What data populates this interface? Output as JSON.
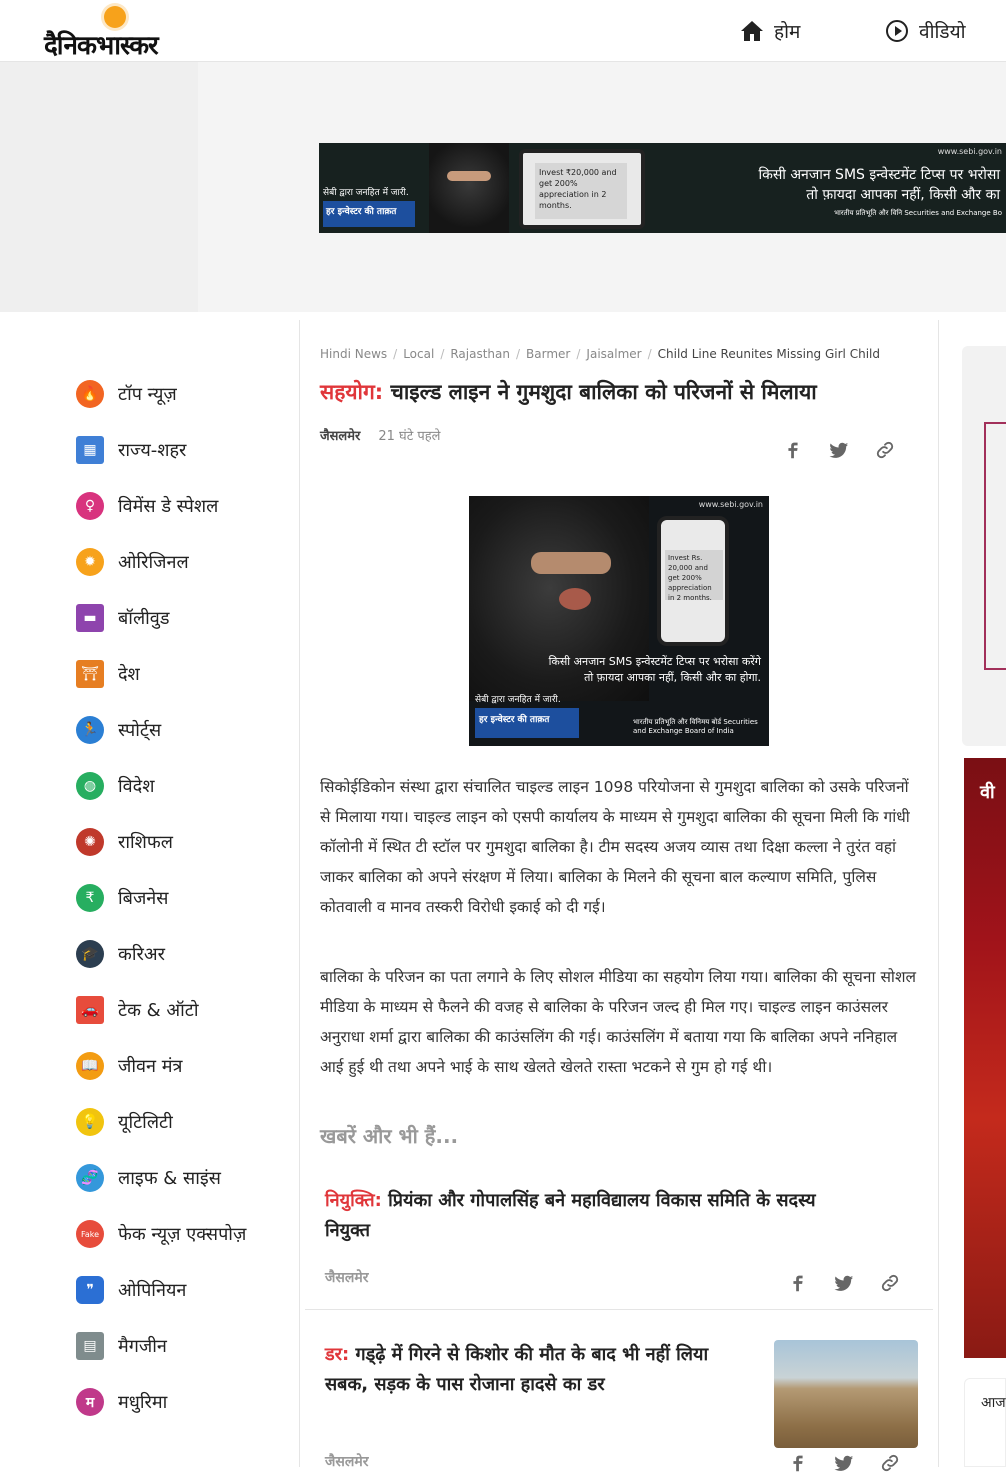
{
  "header": {
    "logo_text": "दैनिकभास्कर",
    "nav_home": "होम",
    "nav_video": "वीडियो"
  },
  "banner_ad": {
    "url": "www.sebi.gov.in",
    "sms_text": "Invest ₹20,000 and get 200% appreciation in 2 months.",
    "left_note": "सेबी द्वारा जनहित में जारी.",
    "left_badge": "हर इन्वेस्टर की ताक़त",
    "line1": "किसी अनजान SMS इन्वेस्टमेंट टिप्स पर भरोसा",
    "line2": "तो फ़ायदा आपका नहीं, किसी और का",
    "right_note": "भारतीय प्रतिभूति और विनि Securities and Exchange Bo"
  },
  "sidebar": {
    "items": [
      {
        "label": "टॉप न्यूज़",
        "icon": "flame-icon",
        "color": "#f26522"
      },
      {
        "label": "राज्य-शहर",
        "icon": "city-icon",
        "color": "#3f7fd6"
      },
      {
        "label": "विमेंस डे स्पेशल",
        "icon": "women-icon",
        "color": "#d8337e"
      },
      {
        "label": "ओरिजिनल",
        "icon": "original-icon",
        "color": "#f7a21b"
      },
      {
        "label": "बॉलीवुड",
        "icon": "clapper-icon",
        "color": "#8e44ad"
      },
      {
        "label": "देश",
        "icon": "gate-icon",
        "color": "#e67e22"
      },
      {
        "label": "स्पोर्ट्स",
        "icon": "runner-icon",
        "color": "#2b7fd4"
      },
      {
        "label": "विदेश",
        "icon": "globe-icon",
        "color": "#27ae60"
      },
      {
        "label": "राशिफल",
        "icon": "zodiac-icon",
        "color": "#c0392b"
      },
      {
        "label": "बिजनेस",
        "icon": "rupee-icon",
        "color": "#27ae60"
      },
      {
        "label": "करिअर",
        "icon": "graduation-cap-icon",
        "color": "#2c3e50"
      },
      {
        "label": "टेक & ऑटो",
        "icon": "car-icon",
        "color": "#e74c3c"
      },
      {
        "label": "जीवन मंत्र",
        "icon": "book-icon",
        "color": "#f39c12"
      },
      {
        "label": "यूटिलिटी",
        "icon": "bulb-icon",
        "color": "#f1c40f"
      },
      {
        "label": "लाइफ & साइंस",
        "icon": "dna-icon",
        "color": "#3498db"
      },
      {
        "label": "फेक न्यूज़ एक्सपोज़",
        "icon": "fake-icon",
        "color": "#e74c3c"
      },
      {
        "label": "ओपिनियन",
        "icon": "quote-icon",
        "color": "#2b6fd4"
      },
      {
        "label": "मैगजीन",
        "icon": "magazine-icon",
        "color": "#7f8c8d"
      },
      {
        "label": "मधुरिमा",
        "icon": "m-icon",
        "color": "#c0398a"
      }
    ]
  },
  "breadcrumb": [
    "Hindi News",
    "Local",
    "Rajasthan",
    "Barmer",
    "Jaisalmer",
    "Child Line Reunites Missing Girl Child"
  ],
  "article": {
    "keyword": "सहयोग:",
    "title": " चाइल्ड लाइन ने गुमशुदा बालिका को परिजनों से मिलाया",
    "city": "जैसलमेर",
    "time": "21 घंटे पहले",
    "image": {
      "url": "www.sebi.gov.in",
      "sms": "Invest Rs. 20,000 and get 200% appreciation in 2 months.",
      "line1": "किसी अनजान SMS इन्वेस्टमेंट टिप्स पर भरोसा करेंगे",
      "line2": "तो फ़ायदा आपका नहीं, किसी और का होगा.",
      "left_note": "सेबी द्वारा जनहित में जारी.",
      "badge": "हर इन्वेस्टर की ताक़त",
      "right_note": "भारतीय प्रतिभूति और विनिमय बोर्ड Securities and Exchange Board of India"
    },
    "para1": "सिकोईडिकोन संस्था द्वारा संचालित चाइल्ड लाइन 1098 परियोजना से गुमशुदा बालिका को उसके परिजनों से मिलाया गया। चाइल्ड लाइन को एसपी कार्यालय के माध्यम से गुमशुदा बालिका की सूचना मिली कि गांधी कॉलोनी में स्थित टी स्टॉल पर गुमशुदा बालिका है। टीम सदस्य अजय व्यास तथा दिक्षा कल्ला ने तुरंत वहां जाकर बालिका को अपने संरक्षण में लिया। बालिका के मिलने की सूचना बाल कल्याण समिति, पुलिस कोतवाली व मानव तस्करी विरोधी इकाई को दी गई।",
    "para2": "बालिका के परिजन का पता लगाने के लिए सोशल मीडिया का सहयोग लिया गया। बालिका की सूचना सोशल मीडिया के माध्यम से फैलने की वजह से बालिका के परिजन जल्द ही मिल गए। चाइल्ड लाइन काउंसलर अनुराधा शर्मा द्वारा बालिका की काउंसलिंग की गई। काउंसलिंग में बताया गया कि बालिका अपने ननिहाल आई हुई थी तथा अपने भाई के साथ खेलते खेलते रास्ता भटकने से गुम हो गई थी।"
  },
  "more_heading": "खबरें और भी हैं...",
  "related": [
    {
      "keyword": "नियुक्ति:",
      "title": " प्रियंका और गोपालसिंह बने महाविद्यालय विकास समिति के सदस्य नियुक्त",
      "city": "जैसलमेर"
    },
    {
      "keyword": "डर:",
      "title": " गड्ढ़े में गिरने से किशोर की मौत के बाद भी नहीं लिया सबक, सड़क के पास रोजाना हादसे का डर",
      "city": "जैसलमेर"
    }
  ],
  "right_rail": {
    "promo_text": "वी",
    "bottom_text": "आज"
  },
  "colors": {
    "accent": "#e0363a",
    "logo_sun": "#f7a21b"
  }
}
